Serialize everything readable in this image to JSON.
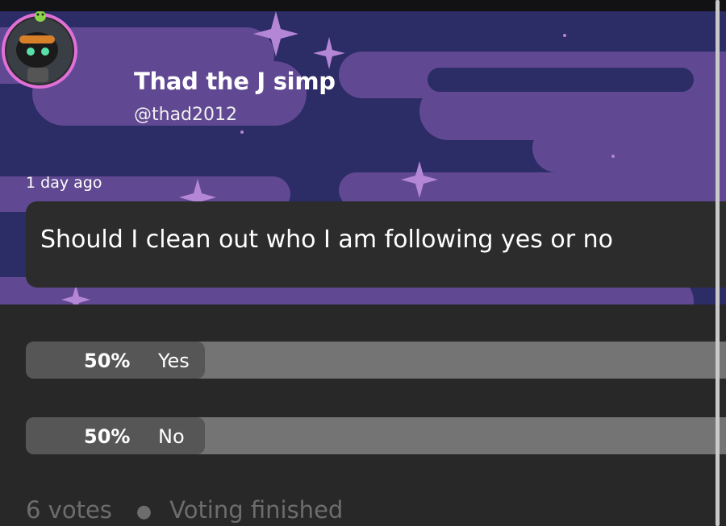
{
  "profile": {
    "display_name": "Thad the J simp",
    "handle": "@thad2012",
    "avatar_icon": "robot-avatar-icon",
    "badge_icon": "frog-badge-icon"
  },
  "post": {
    "timestamp": "1 day ago",
    "question": "Should I clean out who I am following yes or no"
  },
  "poll": {
    "options": [
      {
        "percent": "50%",
        "label": "Yes",
        "fraction": 0.5
      },
      {
        "percent": "50%",
        "label": "No",
        "fraction": 0.5
      }
    ],
    "votes": "6 votes",
    "status": "Voting finished"
  },
  "colors": {
    "banner": "#2c2c66",
    "clouds": "#7a5fa8",
    "sparkles": "#b486d6",
    "avatar_ring": "#e070d8",
    "background": "#282828"
  }
}
